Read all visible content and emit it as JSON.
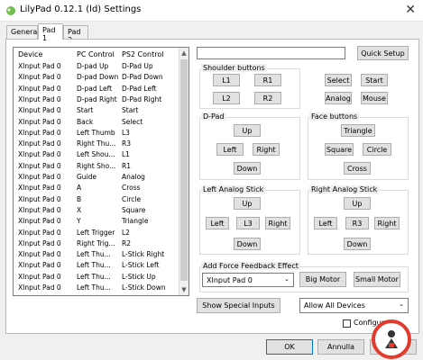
{
  "window": {
    "title": "LilyPad 0.12.1 (ld) Settings",
    "close_glyph": "✕"
  },
  "tabs": [
    {
      "label": "General"
    },
    {
      "label": "Pad 1"
    },
    {
      "label": "Pad 2"
    }
  ],
  "bindings_list": {
    "headers": {
      "device": "Device",
      "pc_control": "PC Control",
      "ps2_control": "PS2 Control"
    },
    "rows": [
      {
        "device": "XInput Pad 0",
        "pc": "D-pad Up",
        "ps2": "D-Pad Up"
      },
      {
        "device": "XInput Pad 0",
        "pc": "D-pad Down",
        "ps2": "D-Pad Down"
      },
      {
        "device": "XInput Pad 0",
        "pc": "D-pad Left",
        "ps2": "D-Pad Left"
      },
      {
        "device": "XInput Pad 0",
        "pc": "D-pad Right",
        "ps2": "D-Pad Right"
      },
      {
        "device": "XInput Pad 0",
        "pc": "Start",
        "ps2": "Start"
      },
      {
        "device": "XInput Pad 0",
        "pc": "Back",
        "ps2": "Select"
      },
      {
        "device": "XInput Pad 0",
        "pc": "Left Thumb",
        "ps2": "L3"
      },
      {
        "device": "XInput Pad 0",
        "pc": "Right Thu...",
        "ps2": "R3"
      },
      {
        "device": "XInput Pad 0",
        "pc": "Left Shou...",
        "ps2": "L1"
      },
      {
        "device": "XInput Pad 0",
        "pc": "Right Sho...",
        "ps2": "R1"
      },
      {
        "device": "XInput Pad 0",
        "pc": "Guide",
        "ps2": "Analog"
      },
      {
        "device": "XInput Pad 0",
        "pc": "A",
        "ps2": "Cross"
      },
      {
        "device": "XInput Pad 0",
        "pc": "B",
        "ps2": "Circle"
      },
      {
        "device": "XInput Pad 0",
        "pc": "X",
        "ps2": "Square"
      },
      {
        "device": "XInput Pad 0",
        "pc": "Y",
        "ps2": "Triangle"
      },
      {
        "device": "XInput Pad 0",
        "pc": "Left Trigger",
        "ps2": "L2"
      },
      {
        "device": "XInput Pad 0",
        "pc": "Right Trig...",
        "ps2": "R2"
      },
      {
        "device": "XInput Pad 0",
        "pc": "Left Thu...",
        "ps2": "L-Stick Right"
      },
      {
        "device": "XInput Pad 0",
        "pc": "Left Thu...",
        "ps2": "L-Stick Left"
      },
      {
        "device": "XInput Pad 0",
        "pc": "Left Thu...",
        "ps2": "L-Stick Up"
      },
      {
        "device": "XInput Pad 0",
        "pc": "Left Thu...",
        "ps2": "L-Stick Down"
      }
    ]
  },
  "quick_setup": "Quick Setup",
  "shoulder": {
    "title": "Shoulder buttons",
    "l1": "L1",
    "r1": "R1",
    "l2": "L2",
    "r2": "R2"
  },
  "system_buttons": {
    "select": "Select",
    "start": "Start",
    "analog": "Analog",
    "mouse": "Mouse"
  },
  "dpad": {
    "title": "D-Pad",
    "up": "Up",
    "left": "Left",
    "right": "Right",
    "down": "Down"
  },
  "face": {
    "title": "Face buttons",
    "triangle": "Triangle",
    "square": "Square",
    "circle": "Circle",
    "cross": "Cross"
  },
  "left_stick": {
    "title": "Left Analog Stick",
    "up": "Up",
    "left": "Left",
    "l3": "L3",
    "right": "Right",
    "down": "Down"
  },
  "right_stick": {
    "title": "Right Analog Stick",
    "up": "Up",
    "left": "Left",
    "r3": "R3",
    "right": "Right",
    "down": "Down"
  },
  "force_feedback": {
    "title": "Add Force Feedback Effect",
    "device": "XInput Pad 0",
    "big_motor": "Big Motor",
    "small_motor": "Small Motor"
  },
  "special_inputs": "Show Special Inputs",
  "device_filter": "Allow All Devices",
  "configure_label": "Configure o",
  "footer": {
    "ok": "OK",
    "cancel": "Annulla"
  },
  "colors": {
    "accent": "#0078d7",
    "button_face": "#e1e1e1",
    "window_bg": "#f0f0f0",
    "watermark": "#e23b2e"
  }
}
